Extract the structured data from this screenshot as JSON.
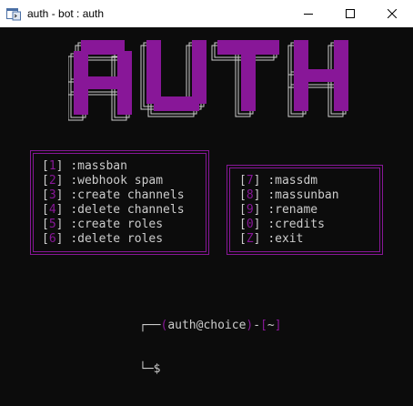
{
  "window": {
    "title": "auth - bot : auth"
  },
  "logo": {
    "text": "AUTH",
    "color": "#881798",
    "shadow_color": "#cccccc"
  },
  "menu_left": [
    {
      "key": "1",
      "label": ":massban"
    },
    {
      "key": "2",
      "label": ":webhook spam"
    },
    {
      "key": "3",
      "label": ":create channels"
    },
    {
      "key": "4",
      "label": ":delete channels"
    },
    {
      "key": "5",
      "label": ":create roles"
    },
    {
      "key": "6",
      "label": ":delete roles"
    }
  ],
  "menu_right": [
    {
      "key": "7",
      "label": ":massdm"
    },
    {
      "key": "8",
      "label": ":massunban"
    },
    {
      "key": "9",
      "label": ":rename"
    },
    {
      "key": "0",
      "label": ":credits"
    },
    {
      "key": "Z",
      "label": ":exit"
    }
  ],
  "prompt": {
    "corner_top": "┌──",
    "user_host": "auth@choice",
    "separator": "-",
    "cwd": "~",
    "corner_bottom": "└─",
    "symbol": "$"
  },
  "colors": {
    "accent": "#881798",
    "text": "#cccccc",
    "background": "#0c0c0c"
  }
}
